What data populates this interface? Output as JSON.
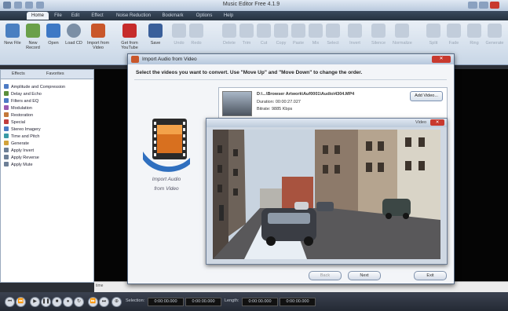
{
  "app": {
    "title": "Music Editor Free 4.1.9"
  },
  "menu_tabs": [
    "Home",
    "File",
    "Edit",
    "Effect",
    "Noise Reduction",
    "Bookmark",
    "Options",
    "Help"
  ],
  "ribbon": [
    {
      "label": "New File",
      "icon": "new-file-icon",
      "color": "#4a7fc1"
    },
    {
      "label": "New Record",
      "icon": "microphone-icon",
      "color": "#6aa04a"
    },
    {
      "label": "Open",
      "icon": "open-folder-icon",
      "color": "#3d78c5"
    },
    {
      "label": "Load CD",
      "icon": "cd-icon",
      "color": "#7b8fa6"
    },
    {
      "label": "Import from Video",
      "icon": "film-icon",
      "color": "#c9572b"
    },
    {
      "label": "Get from YouTube",
      "icon": "youtube-icon",
      "color": "#c62b2b"
    },
    {
      "label": "Save",
      "icon": "save-icon",
      "color": "#3a5f9a"
    }
  ],
  "ribbon_dim": [
    "Undo",
    "Redo",
    "Delete",
    "Trim",
    "Cut",
    "Copy",
    "Paste",
    "Mix",
    "Select",
    "Invert",
    "Silence",
    "Normalize",
    "Split",
    "Fade",
    "Ring",
    "Generate"
  ],
  "left_panel": {
    "tabs": [
      "Effects",
      "Favorites"
    ],
    "items": [
      {
        "label": "Amplitude and Compression",
        "color": "#4d7bc4"
      },
      {
        "label": "Delay and Echo",
        "color": "#5a8f3c"
      },
      {
        "label": "Filters and EQ",
        "color": "#4d7bc4"
      },
      {
        "label": "Modulation",
        "color": "#9a5ab0"
      },
      {
        "label": "Restoration",
        "color": "#c4793a"
      },
      {
        "label": "Special",
        "color": "#c23d3d"
      },
      {
        "label": "Stereo Imagery",
        "color": "#4d7bc4"
      },
      {
        "label": "Time and Pitch",
        "color": "#3a9aa6"
      },
      {
        "label": "Generate",
        "color": "#d2a23a"
      },
      {
        "label": "Apply Invert",
        "color": "#6d7f96"
      },
      {
        "label": "Apply Reverse",
        "color": "#6d7f96"
      },
      {
        "label": "Apply Mute",
        "color": "#6d7f96"
      }
    ]
  },
  "dialog": {
    "title": "Import Audio from Video",
    "instruction": "Select the videos you want to convert. Use \"Move Up\" and \"Move Down\" to change the order.",
    "side_label_line1": "Import Audio",
    "side_label_line2": "from Video",
    "video": {
      "path": "D:\\...\\Browser Artwork\\Auf0001\\Audio\\4304.MP4",
      "duration": "Duration: 00:00:27.027",
      "bitrate": "Bitrate: 9885 Kbps"
    },
    "add_video": "Add Video...",
    "buttons": {
      "back": "Back",
      "next": "Next",
      "exit": "Exit"
    },
    "close": "✕"
  },
  "preview": {
    "title": "Video",
    "close": "✕"
  },
  "bottom": {
    "selection_label": "Selection:",
    "selection_start": "0:00:00.000",
    "selection_end": "0:00:00.000",
    "length_label": "Length:",
    "length_start": "0:00:00.000",
    "length_end": "0:00:00.000",
    "ruler_label": "time"
  }
}
